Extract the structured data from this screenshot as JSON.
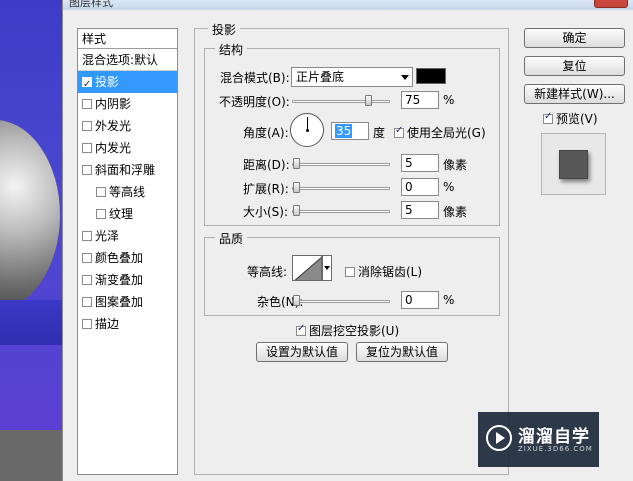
{
  "window": {
    "title": "图层样式"
  },
  "styles_list": {
    "header": "样式",
    "blend_options": "混合选项:默认",
    "items": [
      {
        "label": "投影",
        "checked": true,
        "selected": true
      },
      {
        "label": "内阴影",
        "checked": false
      },
      {
        "label": "外发光",
        "checked": false
      },
      {
        "label": "内发光",
        "checked": false
      },
      {
        "label": "斜面和浮雕",
        "checked": false
      },
      {
        "label": "等高线",
        "checked": false,
        "sub": true
      },
      {
        "label": "纹理",
        "checked": false,
        "sub": true
      },
      {
        "label": "光泽",
        "checked": false
      },
      {
        "label": "颜色叠加",
        "checked": false
      },
      {
        "label": "渐变叠加",
        "checked": false
      },
      {
        "label": "图案叠加",
        "checked": false
      },
      {
        "label": "描边",
        "checked": false
      }
    ]
  },
  "drop_shadow": {
    "group_title": "投影",
    "structure": {
      "title": "结构",
      "blend_mode_label": "混合模式(B):",
      "blend_mode_value": "正片叠底",
      "shadow_color": "#000000",
      "opacity_label": "不透明度(O):",
      "opacity_value": "75",
      "opacity_unit": "%",
      "angle_label": "角度(A):",
      "angle_value": "35",
      "angle_unit": "度",
      "global_light_label": "使用全局光(G)",
      "global_light_checked": true,
      "distance_label": "距离(D):",
      "distance_value": "5",
      "distance_unit": "像素",
      "spread_label": "扩展(R):",
      "spread_value": "0",
      "spread_unit": "%",
      "size_label": "大小(S):",
      "size_value": "5",
      "size_unit": "像素"
    },
    "quality": {
      "title": "品质",
      "contour_label": "等高线:",
      "anti_alias_label": "消除锯齿(L)",
      "anti_alias_checked": false,
      "noise_label": "杂色(N):",
      "noise_value": "0",
      "noise_unit": "%"
    },
    "knockout_label": "图层挖空投影(U)",
    "knockout_checked": true,
    "make_default_label": "设置为默认值",
    "reset_default_label": "复位为默认值"
  },
  "buttons": {
    "ok": "确定",
    "reset": "复位",
    "new_style": "新建样式(W)...",
    "preview_label": "预览(V)",
    "preview_checked": true
  },
  "watermark": {
    "title": "溜溜自学",
    "subtitle": "ZIXUE.3D66.COM"
  }
}
